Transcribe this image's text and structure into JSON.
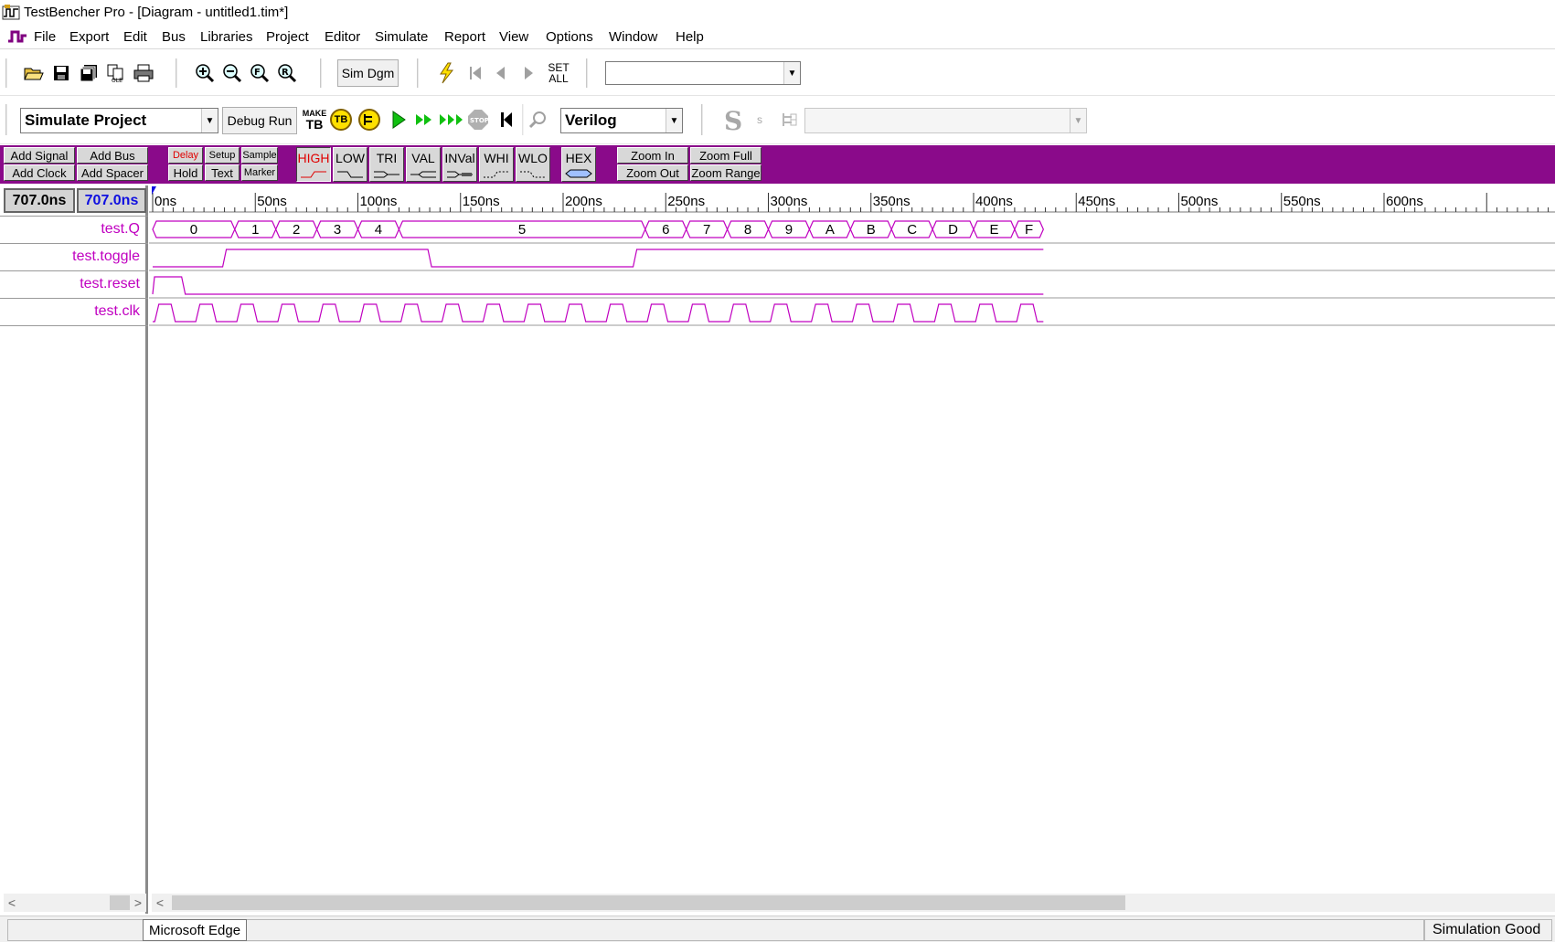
{
  "window": {
    "title": "TestBencher Pro - [Diagram - untitled1.tim*]"
  },
  "menu": [
    "File",
    "Export",
    "Edit",
    "Bus",
    "Libraries",
    "Project",
    "Editor",
    "Simulate",
    "Report",
    "View",
    "Options",
    "Window",
    "Help"
  ],
  "toolbar1": {
    "sim_dgm_label": "Sim Dgm",
    "set_all_label": [
      "SET",
      "ALL"
    ],
    "combo_value": ""
  },
  "toolbar2": {
    "mode_combo": "Simulate Project",
    "debug_run_label": "Debug Run",
    "make_tb_label": [
      "MAKE",
      "TB"
    ],
    "tb_badge": "TB",
    "stop_label": "STOP",
    "language_combo": "Verilog",
    "s_big": "S",
    "s_small": "s"
  },
  "purple_toolbar": {
    "add_signal": "Add Signal",
    "add_bus": "Add Bus",
    "add_clock": "Add Clock",
    "add_spacer": "Add Spacer",
    "delay": "Delay",
    "setup": "Setup",
    "sample": "Sample",
    "hold": "Hold",
    "text": "Text",
    "marker": "Marker",
    "high": "HIGH",
    "low": "LOW",
    "tri": "TRI",
    "val": "VAL",
    "inval": "INVal",
    "whi": "WHI",
    "wlo": "WLO",
    "hex": "HEX",
    "zoom_in": "Zoom In",
    "zoom_full": "Zoom Full",
    "zoom_out": "Zoom Out",
    "zoom_range": "Zoom Range",
    "accent": "#8a0a8a"
  },
  "time_readouts": {
    "cursor_time": "707.0ns",
    "marker_time": "707.0ns"
  },
  "ruler": {
    "labels": [
      "0ns",
      "50ns",
      "100ns",
      "150ns",
      "200ns",
      "250ns",
      "300ns",
      "350ns",
      "400ns",
      "450ns",
      "500ns",
      "550ns",
      "600ns"
    ]
  },
  "signals": [
    {
      "name": "test.Q",
      "type": "bus",
      "segments": [
        {
          "start": 0,
          "end": 40,
          "value": "0"
        },
        {
          "start": 40,
          "end": 60,
          "value": "1"
        },
        {
          "start": 60,
          "end": 80,
          "value": "2"
        },
        {
          "start": 80,
          "end": 100,
          "value": "3"
        },
        {
          "start": 100,
          "end": 120,
          "value": "4"
        },
        {
          "start": 120,
          "end": 240,
          "value": "5"
        },
        {
          "start": 240,
          "end": 260,
          "value": "6"
        },
        {
          "start": 260,
          "end": 280,
          "value": "7"
        },
        {
          "start": 280,
          "end": 300,
          "value": "8"
        },
        {
          "start": 300,
          "end": 320,
          "value": "9"
        },
        {
          "start": 320,
          "end": 340,
          "value": "A"
        },
        {
          "start": 340,
          "end": 360,
          "value": "B"
        },
        {
          "start": 360,
          "end": 380,
          "value": "C"
        },
        {
          "start": 380,
          "end": 400,
          "value": "D"
        },
        {
          "start": 400,
          "end": 420,
          "value": "E"
        },
        {
          "start": 420,
          "end": 434,
          "value": "F"
        }
      ]
    },
    {
      "name": "test.toggle",
      "type": "bit",
      "edges": [
        [
          0,
          0
        ],
        [
          35,
          1
        ],
        [
          135,
          0
        ],
        [
          235,
          1
        ]
      ],
      "end": 434
    },
    {
      "name": "test.reset",
      "type": "bit",
      "edges": [
        [
          0,
          1
        ],
        [
          15,
          0
        ]
      ],
      "end": 434
    },
    {
      "name": "test.clk",
      "type": "clock",
      "period": 20,
      "end": 434
    }
  ],
  "status": {
    "tooltip": "Microsoft Edge",
    "message": "Simulation Good"
  },
  "colors": {
    "waveform": "#c000c0",
    "signal_name": "#c000c0",
    "marker_time": "#1010e0"
  }
}
